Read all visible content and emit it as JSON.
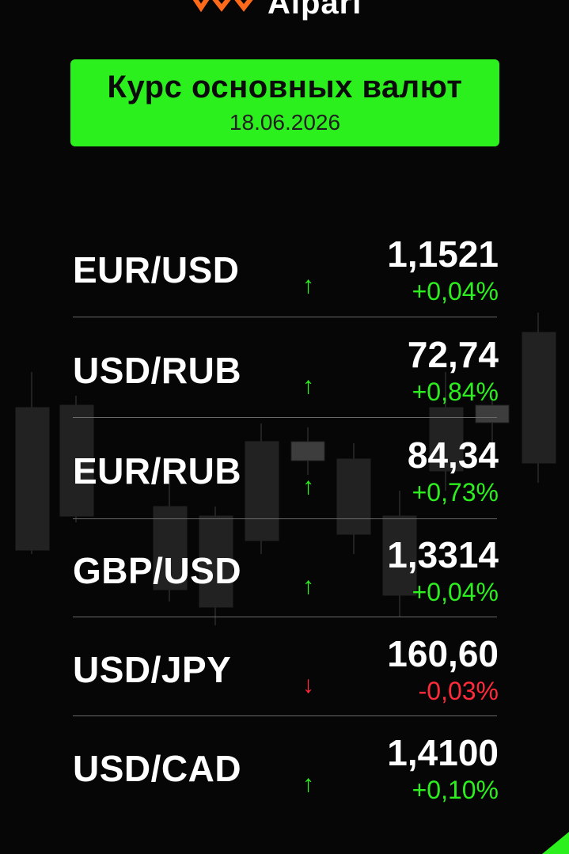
{
  "brand": {
    "name": "Alpari",
    "accent": "#2cf01e",
    "logo_color": "#ff6a1a"
  },
  "header": {
    "title": "Курс основных валют",
    "date": "18.06.2026"
  },
  "rates": [
    {
      "pair": "EUR/USD",
      "value": "1,1521",
      "change": "+0,04%",
      "direction": "up",
      "arrow": "↑"
    },
    {
      "pair": "USD/RUB",
      "value": "72,74",
      "change": "+0,84%",
      "direction": "up",
      "arrow": "↑"
    },
    {
      "pair": "EUR/RUB",
      "value": "84,34",
      "change": "+0,73%",
      "direction": "up",
      "arrow": "↑"
    },
    {
      "pair": "GBP/USD",
      "value": "1,3314",
      "change": "+0,04%",
      "direction": "up",
      "arrow": "↑"
    },
    {
      "pair": "USD/JPY",
      "value": "160,60",
      "change": "-0,03%",
      "direction": "down",
      "arrow": "↓"
    },
    {
      "pair": "USD/CAD",
      "value": "1,4100",
      "change": "+0,10%",
      "direction": "up",
      "arrow": "↑"
    }
  ],
  "colors": {
    "up": "#2cf01e",
    "down": "#ff2a3a",
    "background": "#060606"
  }
}
